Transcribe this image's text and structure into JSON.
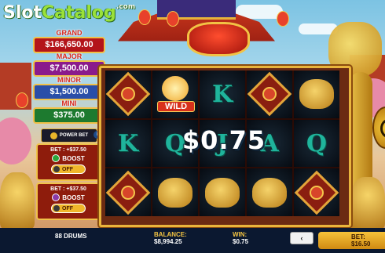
{
  "logo": {
    "part1": "Slot",
    "part2": "Catalog",
    "suffix": ".com"
  },
  "jackpots": [
    {
      "name": "GRAND",
      "amount": "$166,650.00"
    },
    {
      "name": "MAJOR",
      "amount": "$7,500.00"
    },
    {
      "name": "MINOR",
      "amount": "$1,500.00"
    },
    {
      "name": "MINI",
      "amount": "$375.00"
    }
  ],
  "power_bet": {
    "label": "POWER BET",
    "info": "i"
  },
  "boosts": [
    {
      "bet_text": "BET : +$37.50",
      "label": "BOOST",
      "state": "OFF"
    },
    {
      "bet_text": "BET : +$37.50",
      "label": "BOOST",
      "state": "OFF"
    }
  ],
  "reels": [
    [
      "lantern-diamond",
      "letter-K",
      "lion-drum-diamond"
    ],
    [
      "wild",
      "letter-Q",
      "golden-lion"
    ],
    [
      "letter-K",
      "letter-J",
      "golden-dragon"
    ],
    [
      "lantern-diamond",
      "letter-A",
      "golden-lion"
    ],
    [
      "golden-lion",
      "letter-Q",
      "lantern-diamond"
    ]
  ],
  "symbol_text": {
    "letter-K": "K",
    "letter-Q": "Q",
    "letter-J": "J",
    "letter-A": "A",
    "wild": "WILD"
  },
  "win_display": "$0.75",
  "bottom_bar": {
    "game_name": "88 DRUMS",
    "balance_label": "BALANCE:",
    "balance_value": "$8,994.25",
    "win_label": "WIN:",
    "win_value": "$0.75",
    "bet_label": "BET:",
    "bet_value": "$16.50",
    "prev_icon": "‹"
  },
  "colors": {
    "frame_gold": "#e9b53c",
    "letter_teal": "#1fb49c",
    "panel_red": "#8e1c0c"
  }
}
